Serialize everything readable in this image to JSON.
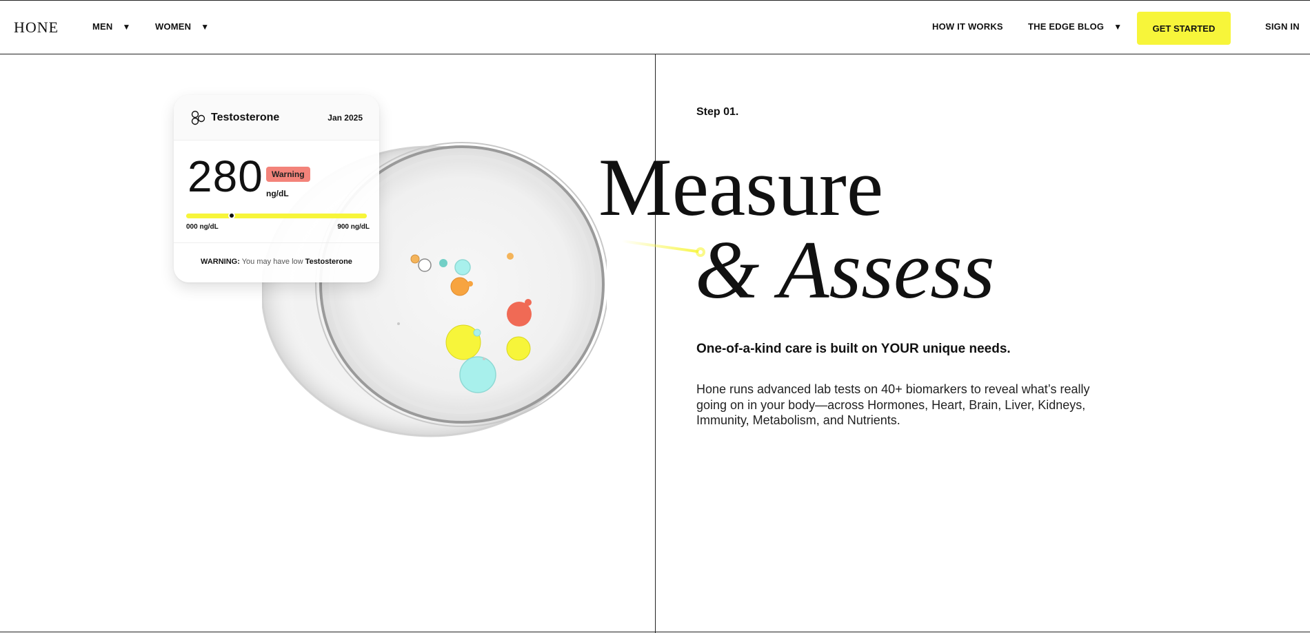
{
  "header": {
    "logo": "HONE",
    "nav_left": [
      {
        "label": "MEN",
        "caret": "▼"
      },
      {
        "label": "WOMEN",
        "caret": "▼"
      }
    ],
    "nav_right": {
      "how_it_works": "HOW IT WORKS",
      "blog": "THE EDGE BLOG",
      "blog_caret": "▼",
      "cta": "GET STARTED",
      "sign_in": "SIGN IN"
    }
  },
  "card": {
    "title": "Testosterone",
    "date": "Jan 2025",
    "value": "280",
    "badge": "Warning",
    "unit": "ng/dL",
    "range_low": "000 ng/dL",
    "range_high": "900 ng/dL",
    "level_fraction": 0.25,
    "footer_strong": "WARNING:",
    "footer_text": " You may have low ",
    "footer_marker": "Testosterone"
  },
  "hero": {
    "step": "Step 01.",
    "headline_1": "Measure",
    "headline_2": "& Assess",
    "lead": "One-of-a-kind care is built on YOUR unique needs.",
    "body": "Hone runs advanced lab tests on 40+ biomarkers to reveal what’s really going on in your body—across Hormones, Heart, Brain, Liver, Kidneys, Immunity, Metabolism, and Nutrients."
  },
  "colors": {
    "accent_yellow": "#f7f53a",
    "warning_badge": "#f3837a",
    "text": "#111111"
  },
  "icons": {
    "card_icon": "molecule-icon",
    "dropdown_caret": "chevron-down-icon"
  }
}
